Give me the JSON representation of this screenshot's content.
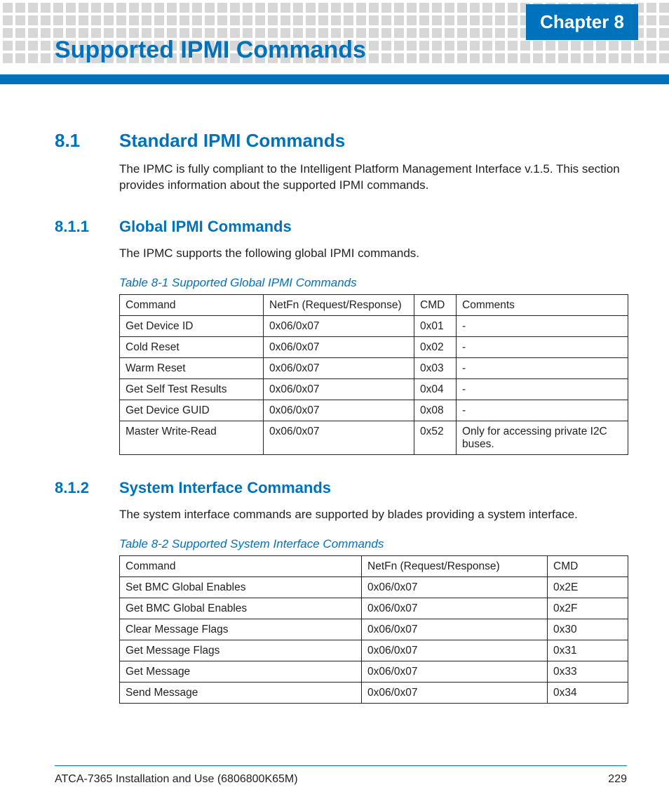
{
  "chapter_tab": "Chapter 8",
  "page_title": "Supported IPMI Commands",
  "section_8_1": {
    "num": "8.1",
    "title": "Standard IPMI Commands",
    "para": "The IPMC is fully compliant to the Intelligent Platform Management Interface v.1.5. This section provides information about the supported IPMI commands."
  },
  "section_8_1_1": {
    "num": "8.1.1",
    "title": "Global IPMI Commands",
    "para": "The IPMC supports the following global IPMI commands.",
    "table_caption": "Table 8-1 Supported Global IPMI Commands",
    "headers": [
      "Command",
      "NetFn (Request/Response)",
      "CMD",
      "Comments"
    ],
    "rows": [
      [
        "Get Device ID",
        "0x06/0x07",
        "0x01",
        "-"
      ],
      [
        "Cold Reset",
        "0x06/0x07",
        "0x02",
        "-"
      ],
      [
        "Warm Reset",
        "0x06/0x07",
        "0x03",
        "-"
      ],
      [
        "Get Self Test Results",
        "0x06/0x07",
        "0x04",
        "-"
      ],
      [
        "Get Device GUID",
        "0x06/0x07",
        "0x08",
        "-"
      ],
      [
        "Master Write-Read",
        "0x06/0x07",
        "0x52",
        "Only for accessing private I2C buses."
      ]
    ]
  },
  "section_8_1_2": {
    "num": "8.1.2",
    "title": "System Interface Commands",
    "para": "The system interface commands are supported by blades providing a system interface.",
    "table_caption": "Table 8-2 Supported System Interface Commands",
    "headers": [
      "Command",
      "NetFn (Request/Response)",
      "CMD"
    ],
    "rows": [
      [
        "Set BMC Global Enables",
        "0x06/0x07",
        "0x2E"
      ],
      [
        "Get BMC Global Enables",
        "0x06/0x07",
        "0x2F"
      ],
      [
        "Clear Message Flags",
        "0x06/0x07",
        "0x30"
      ],
      [
        "Get Message Flags",
        "0x06/0x07",
        "0x31"
      ],
      [
        "Get Message",
        "0x06/0x07",
        "0x33"
      ],
      [
        "Send Message",
        "0x06/0x07",
        "0x34"
      ]
    ]
  },
  "footer": {
    "left": "ATCA-7365 Installation and Use (6806800K65M)",
    "right": "229"
  }
}
